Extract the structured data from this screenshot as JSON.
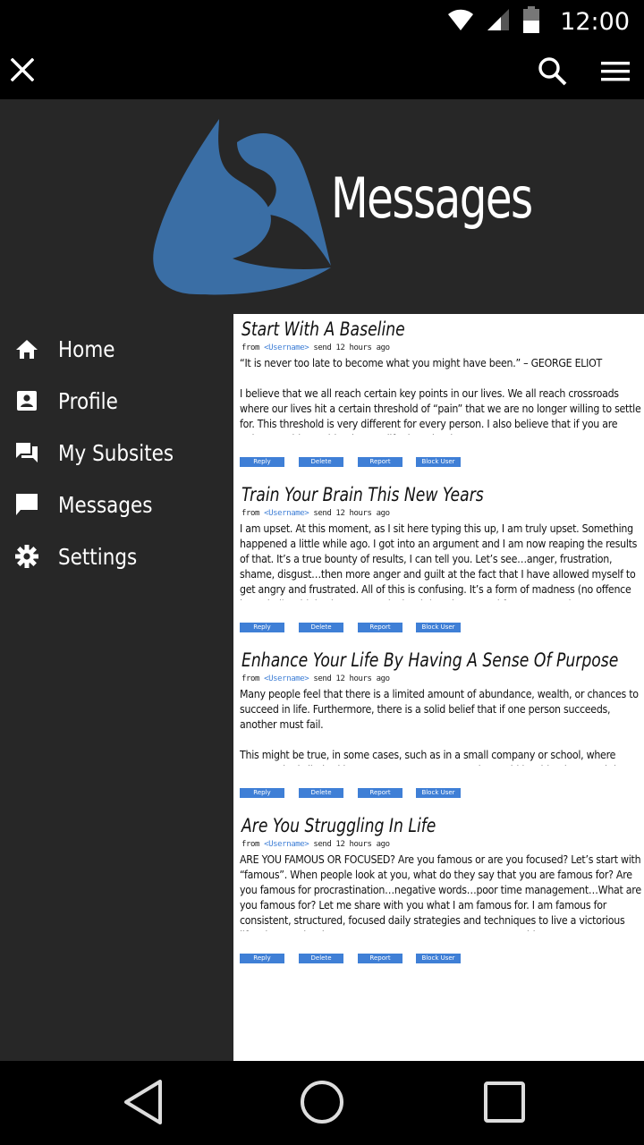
{
  "status": {
    "time": "12:00"
  },
  "header": {
    "title": "Messages"
  },
  "nav": {
    "items": [
      {
        "label": "Home",
        "icon": "home-icon"
      },
      {
        "label": "Profile",
        "icon": "contact-card-icon"
      },
      {
        "label": "My Subsites",
        "icon": "forum-icon"
      },
      {
        "label": "Messages",
        "icon": "chat-icon"
      },
      {
        "label": "Settings",
        "icon": "gear-icon"
      }
    ]
  },
  "messages": [
    {
      "title": "Start With A Baseline",
      "from": "from",
      "username": "<Username>",
      "sent": "send 12 hours ago",
      "paragraphs": [
        "“It is never too late to become what you might have been.” – GEORGE ELIOT",
        "I believe that we all reach certain key points in our lives. We all reach crossroads where our lives hit a certain threshold of “pain” that we are no longer willing to settle for. This threshold is very different for every person. I also believe that if you are unhappy with anything in your life then that is"
      ],
      "actions": {
        "reply": "Reply",
        "delete": "Delete",
        "report": "Report",
        "block": "Block User"
      }
    },
    {
      "title": "Train Your Brain This New Years",
      "from": "from",
      "username": "<Username>",
      "sent": "send 12 hours ago",
      "paragraphs": [
        "I am upset. At this moment, as I sit here typing this up, I am truly upset. Something happened a little while ago. I got into an argument and I am now reaping the results of that. It’s a true bounty of results, I can tell you. Let’s see…anger, frustration, shame, disgust…then more anger and guilt at the fact that I have allowed myself to get angry and frustrated. All of this is confusing. It’s a form of madness (no offence intended). I think what’s worse is that it is quite normal for most people."
      ],
      "actions": {
        "reply": "Reply",
        "delete": "Delete",
        "report": "Report",
        "block": "Block User"
      }
    },
    {
      "title": "Enhance Your Life By Having A Sense Of Purpose",
      "from": "from",
      "username": "<Username>",
      "sent": "send 12 hours ago",
      "paragraphs": [
        "Many people feel that there is a limited amount of abundance, wealth, or chances to succeed in life. Furthermore, there is a solid belief that if one person succeeds, another must fail.",
        "This might be true, in some cases, such as in a small company or school, where opportunity is limited by management. However, the world is a big place, and there are opportunities created from"
      ],
      "actions": {
        "reply": "Reply",
        "delete": "Delete",
        "report": "Report",
        "block": "Block User"
      }
    },
    {
      "title": "Are You Struggling In Life",
      "from": "from",
      "username": "<Username>",
      "sent": "send 12 hours ago",
      "paragraphs": [
        "ARE YOU FAMOUS OR FOCUSED?  Are you famous or are you focused? Let’s start with “famous”. When people look at you, what do they say that you are famous for? Are you famous for procrastination…negative words…poor time management…What are you famous for? Let me share with you what I am famous for. I am famous for consistent, structured, focused daily strategies and techniques to live a victorious life. I know…that is a pretty strong statement! You see, I would"
      ],
      "actions": {
        "reply": "Reply",
        "delete": "Delete",
        "report": "Report",
        "block": "Block User"
      }
    }
  ],
  "colors": {
    "accent": "#3f7fd6",
    "logo": "#3a6ea5",
    "drawer": "#272727"
  }
}
